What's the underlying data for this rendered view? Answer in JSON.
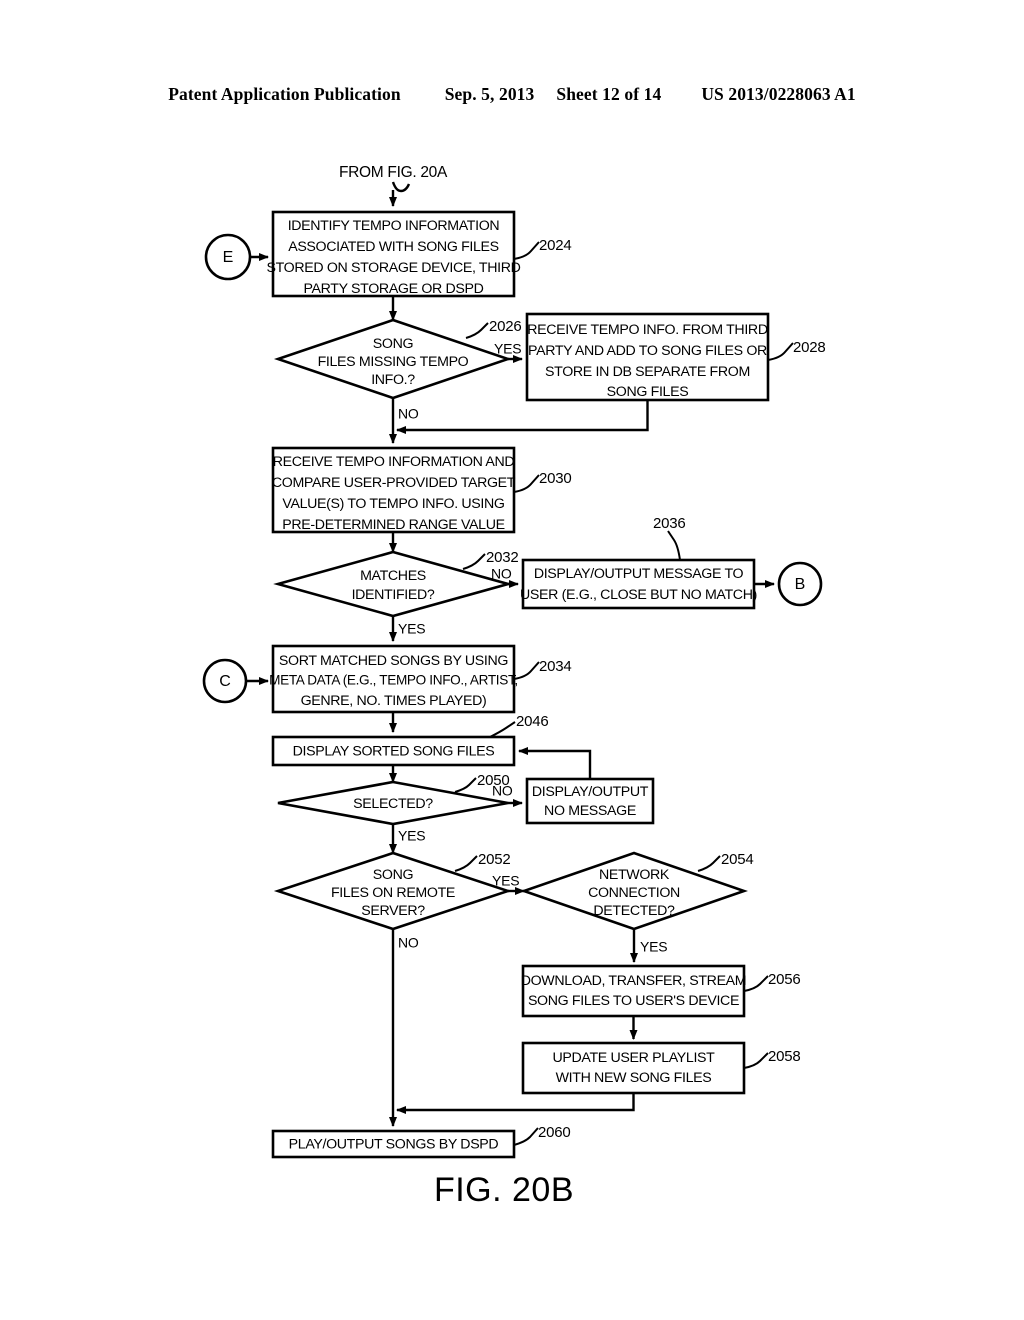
{
  "header": {
    "publication": "Patent Application Publication",
    "date": "Sep. 5, 2013",
    "sheet": "Sheet 12 of 14",
    "number": "US 2013/0228063 A1"
  },
  "figure": {
    "caption": "FIG. 20B",
    "entry_label": "FROM FIG. 20A"
  },
  "connectors": {
    "e": "E",
    "c": "C",
    "b": "B"
  },
  "branch_labels": {
    "yes": "YES",
    "no": "NO"
  },
  "nodes": {
    "n2024": {
      "ref": "2024",
      "type": "process",
      "lines": [
        "IDENTIFY TEMPO INFORMATION",
        "ASSOCIATED WITH SONG FILES",
        "STORED ON STORAGE DEVICE, THIRD",
        "PARTY STORAGE OR DSPD"
      ]
    },
    "n2026": {
      "ref": "2026",
      "type": "decision",
      "lines": [
        "SONG",
        "FILES MISSING TEMPO",
        "INFO.?"
      ],
      "yes": "YES",
      "no": "NO"
    },
    "n2028": {
      "ref": "2028",
      "type": "process",
      "lines": [
        "RECEIVE TEMPO INFO. FROM THIRD",
        "PARTY AND ADD TO SONG FILES OR",
        "STORE IN DB SEPARATE FROM",
        "SONG FILES"
      ]
    },
    "n2030": {
      "ref": "2030",
      "type": "process",
      "lines": [
        "RECEIVE TEMPO INFORMATION AND",
        "COMPARE USER-PROVIDED TARGET",
        "VALUE(S) TO TEMPO INFO. USING",
        "PRE-DETERMINED RANGE VALUE"
      ]
    },
    "n2032": {
      "ref": "2032",
      "type": "decision",
      "lines": [
        "MATCHES",
        "IDENTIFIED?"
      ],
      "yes": "YES",
      "no": "NO"
    },
    "n2036": {
      "ref": "2036",
      "type": "process",
      "lines": [
        "DISPLAY/OUTPUT MESSAGE TO",
        "USER (E.G., CLOSE BUT NO MATCH)"
      ]
    },
    "n2034": {
      "ref": "2034",
      "type": "process",
      "lines": [
        "SORT MATCHED SONGS BY USING",
        "META DATA (E.G., TEMPO INFO., ARTIST,",
        "GENRE, NO. TIMES PLAYED)"
      ]
    },
    "n2046": {
      "ref": "2046",
      "type": "process",
      "lines": [
        "DISPLAY SORTED SONG FILES"
      ]
    },
    "n2050": {
      "ref": "2050",
      "type": "decision",
      "lines": [
        "SELECTED?"
      ],
      "yes": "YES",
      "no": "NO"
    },
    "n_no_message": {
      "ref": "",
      "type": "process",
      "lines": [
        "DISPLAY/OUTPUT",
        "NO MESSAGE"
      ]
    },
    "n2052": {
      "ref": "2052",
      "type": "decision",
      "lines": [
        "SONG",
        "FILES ON REMOTE",
        "SERVER?"
      ],
      "yes": "YES",
      "no": "NO"
    },
    "n2054": {
      "ref": "2054",
      "type": "decision",
      "lines": [
        "NETWORK",
        "CONNECTION",
        "DETECTED?"
      ],
      "yes": "YES"
    },
    "n2056": {
      "ref": "2056",
      "type": "process",
      "lines": [
        "DOWNLOAD, TRANSFER, STREAM",
        "SONG FILES TO USER'S DEVICE"
      ]
    },
    "n2058": {
      "ref": "2058",
      "type": "process",
      "lines": [
        "UPDATE USER PLAYLIST",
        "WITH NEW SONG FILES"
      ]
    },
    "n2060": {
      "ref": "2060",
      "type": "process",
      "lines": [
        "PLAY/OUTPUT SONGS BY DSPD"
      ]
    }
  },
  "colors": {
    "ink": "#000000",
    "paper": "#ffffff"
  }
}
